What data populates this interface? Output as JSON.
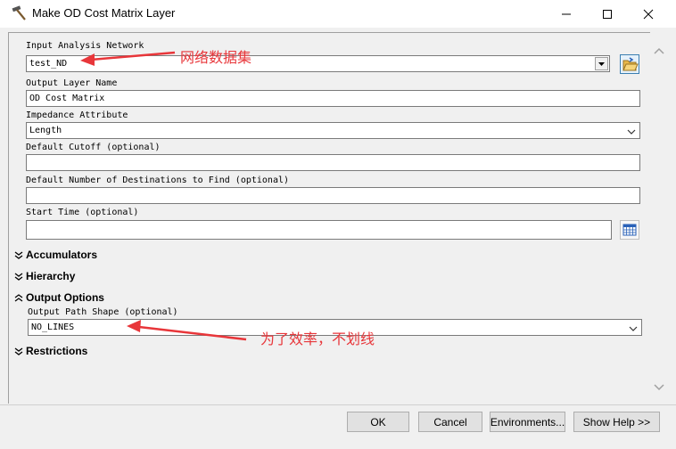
{
  "window": {
    "title": "Make OD Cost Matrix Layer",
    "icon": "hammer-icon"
  },
  "form": {
    "input_network": {
      "label": "Input Analysis Network",
      "value": "test_ND"
    },
    "output_layer": {
      "label": "Output Layer Name",
      "value": "OD Cost Matrix"
    },
    "impedance": {
      "label": "Impedance Attribute",
      "value": "Length"
    },
    "cutoff": {
      "label": "Default Cutoff (optional)",
      "value": ""
    },
    "num_destinations": {
      "label": "Default Number of Destinations to Find (optional)",
      "value": ""
    },
    "start_time": {
      "label": "Start Time (optional)",
      "value": ""
    },
    "accumulators": {
      "label": "Accumulators"
    },
    "hierarchy": {
      "label": "Hierarchy"
    },
    "output_options": {
      "label": "Output Options"
    },
    "output_path_shape": {
      "label": "Output Path Shape (optional)",
      "value": "NO_LINES"
    },
    "restrictions": {
      "label": "Restrictions"
    }
  },
  "annotations": {
    "network_note": "网络数据集",
    "lines_note": "为了效率，不划线",
    "color": "#e8363a"
  },
  "buttons": {
    "ok": "OK",
    "cancel": "Cancel",
    "environments": "Environments...",
    "show_help": "Show Help >>"
  }
}
